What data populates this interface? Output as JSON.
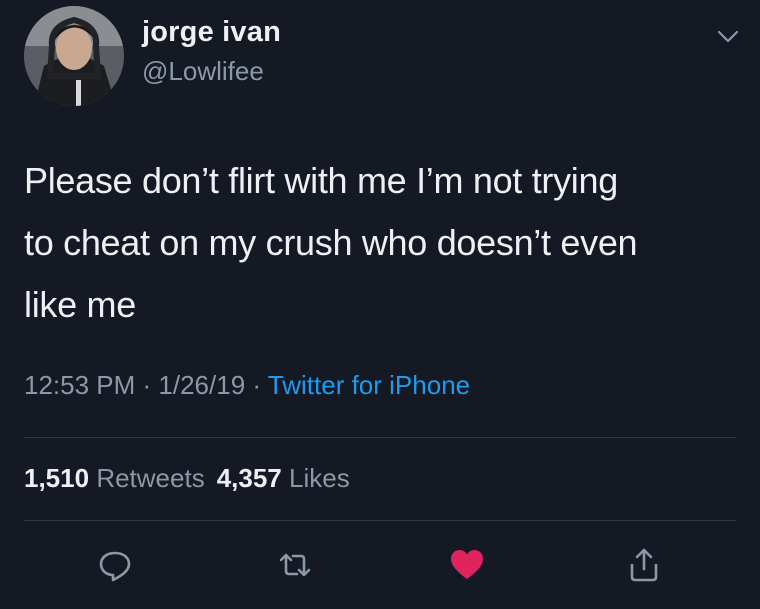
{
  "user": {
    "display_name": "jorge ivan",
    "handle": "@Lowlifee"
  },
  "tweet": {
    "lines": [
      "Please don’t flirt with me I’m not trying",
      "to cheat on my crush who doesn’t even",
      "like me"
    ],
    "time": "12:53 PM",
    "separator": " · ",
    "date": "1/26/19",
    "source": "Twitter for iPhone"
  },
  "stats": {
    "retweets_count": "1,510",
    "retweets_label": "Retweets",
    "likes_count": "4,357",
    "likes_label": "Likes"
  },
  "icons": {
    "menu": "chevron-down-icon",
    "reply": "reply-icon",
    "retweet": "retweet-icon",
    "like": "heart-icon",
    "share": "share-icon"
  },
  "colors": {
    "background": "#141923",
    "link": "#1d9bf0",
    "like_active": "#e0245e",
    "secondary_text": "#8b98a5"
  },
  "state": {
    "liked": true
  }
}
